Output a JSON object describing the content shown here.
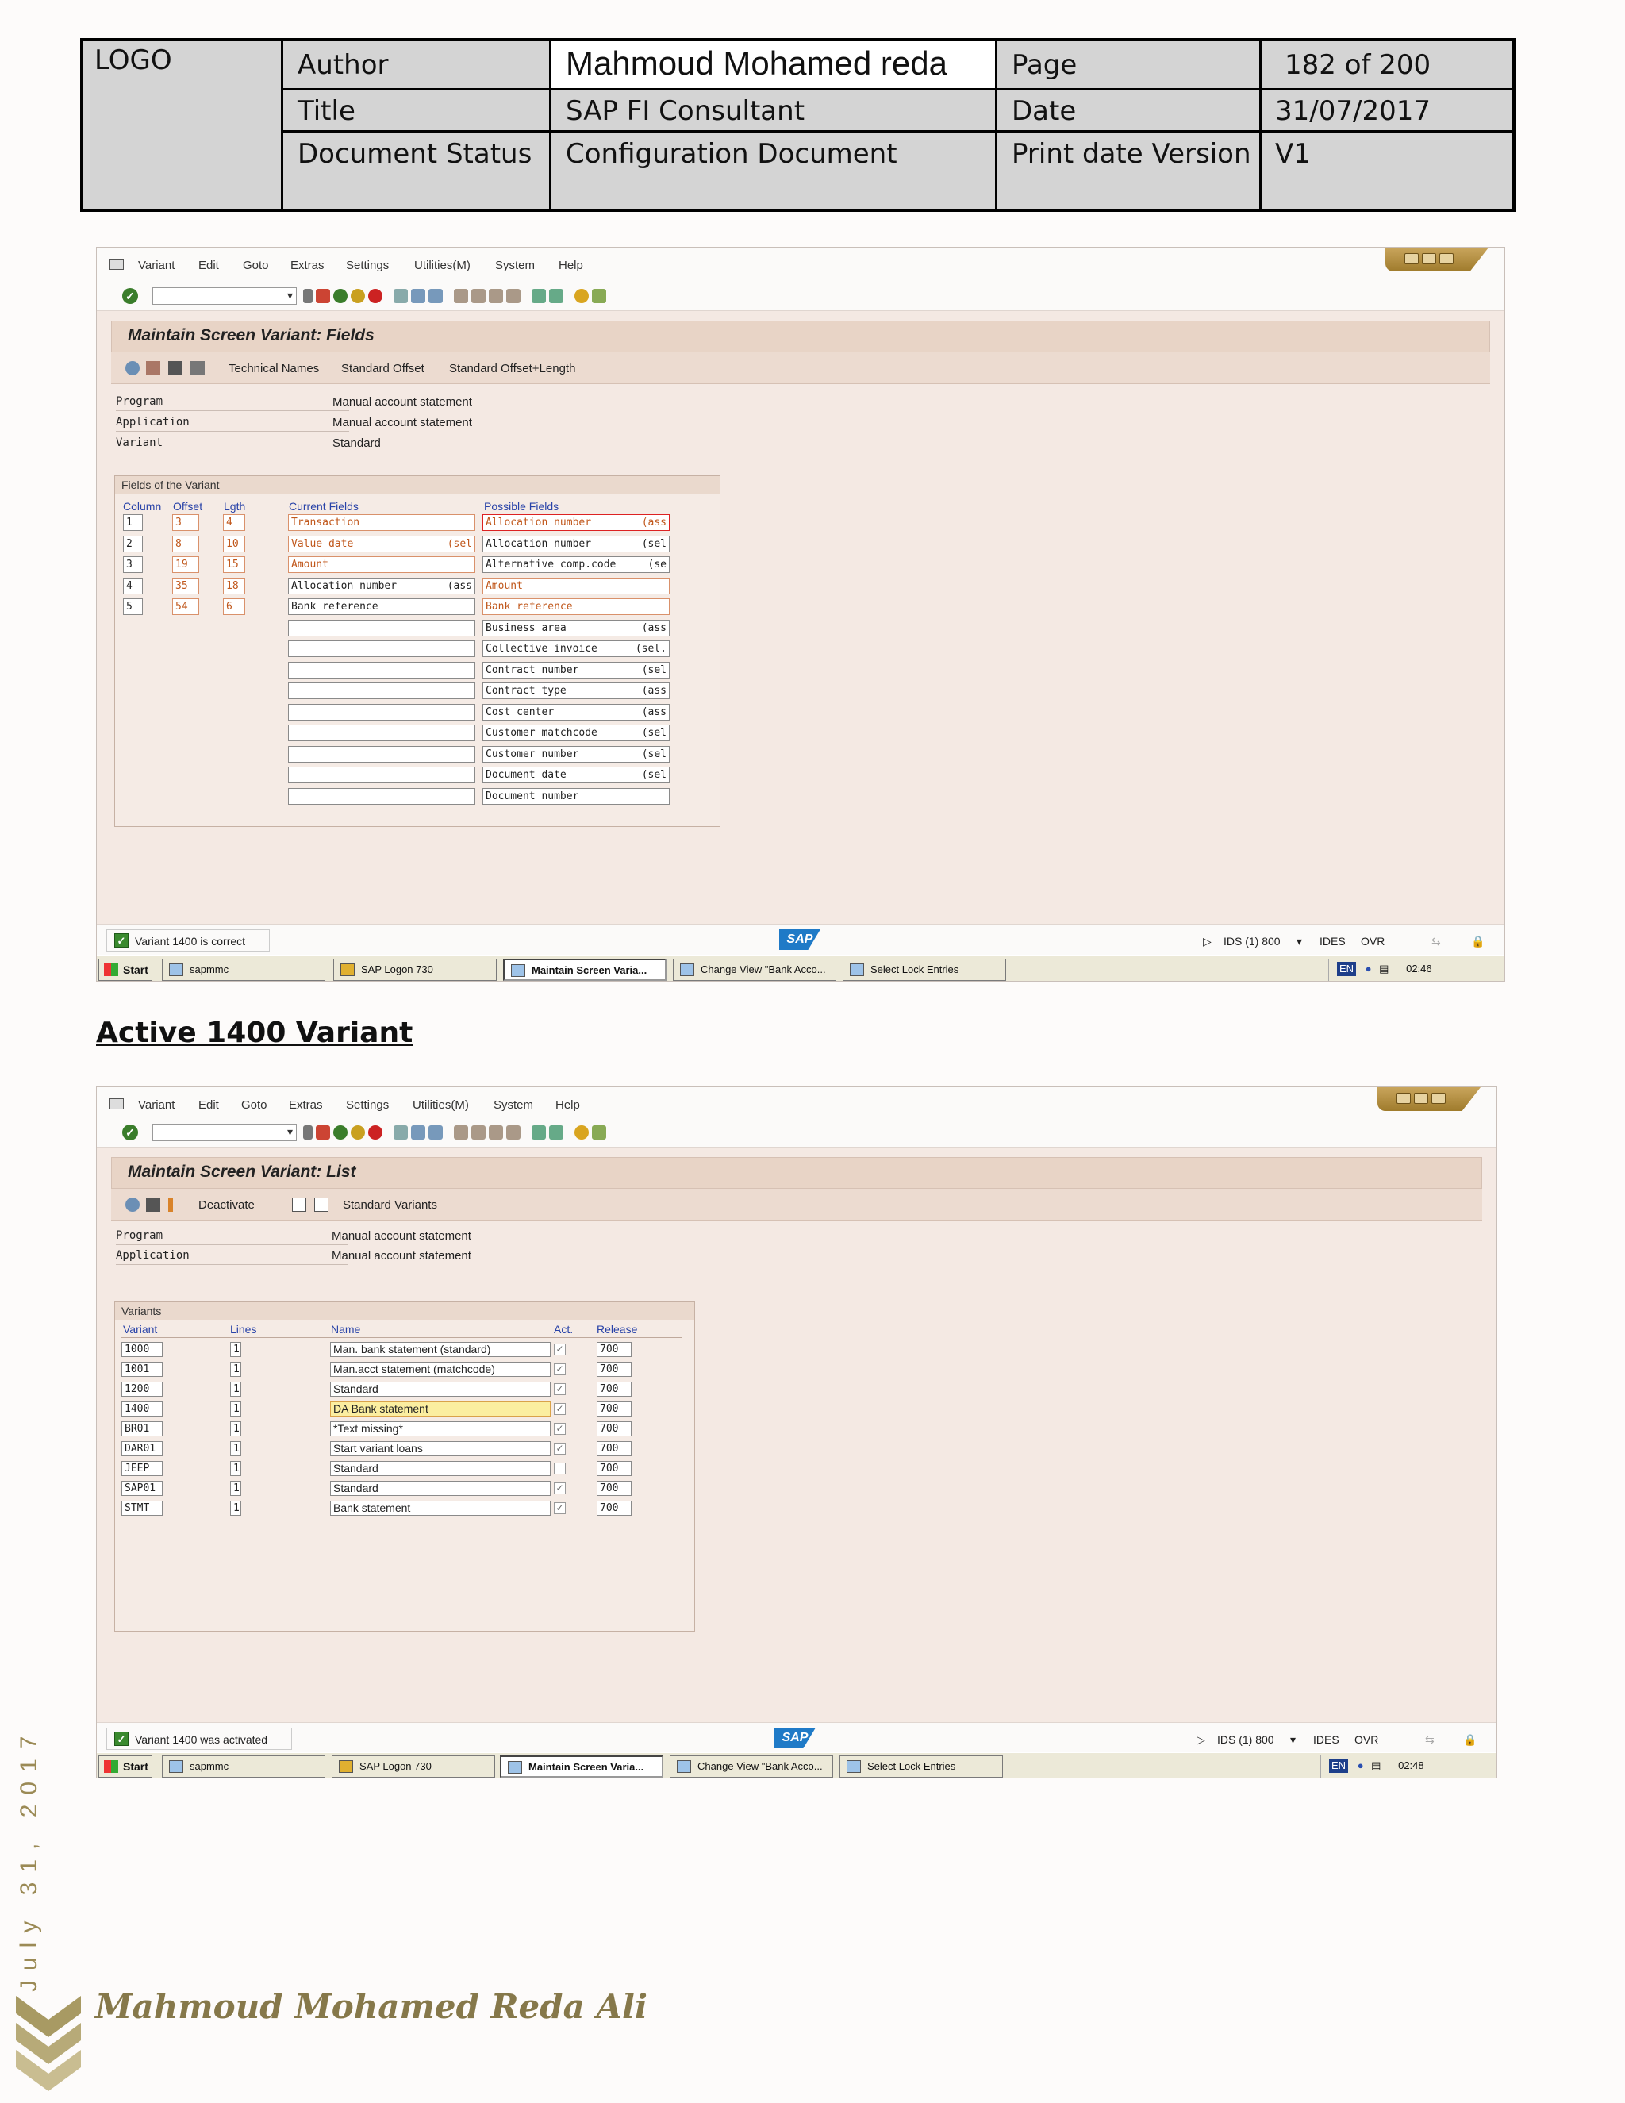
{
  "header": {
    "logo": "LOGO",
    "author_label": "Author",
    "author_value": "Mahmoud Mohamed reda",
    "page_label": "Page",
    "page_value": "182 of 200",
    "title_label": "Title",
    "title_value": "SAP FI Consultant",
    "date_label": "Date",
    "date_value": "31/07/2017",
    "status_label": "Document Status",
    "status_value": "Configuration Document",
    "version_label": "Print date Version",
    "version_value": "V1"
  },
  "menu": [
    "Variant",
    "Edit",
    "Goto",
    "Extras",
    "Settings",
    "Utilities(M)",
    "System",
    "Help"
  ],
  "screen1": {
    "title": "Maintain Screen Variant: Fields",
    "toolbar": [
      "Technical Names",
      "Standard Offset",
      "Standard Offset+Length"
    ],
    "fields": [
      {
        "label": "Program",
        "value": "Manual account statement"
      },
      {
        "label": "Application",
        "value": "Manual account statement"
      },
      {
        "label": "Variant",
        "value": "Standard"
      }
    ],
    "group_title": "Fields of the Variant",
    "col_headers": [
      "Column",
      "Offset",
      "Lgth",
      "Current Fields",
      "Possible Fields"
    ],
    "rows": [
      {
        "col": "1",
        "off": "3",
        "len": "4",
        "field": "Transaction",
        "sfx": ""
      },
      {
        "col": "2",
        "off": "8",
        "len": "10",
        "field": "Value date",
        "sfx": "(sel"
      },
      {
        "col": "3",
        "off": "19",
        "len": "15",
        "field": "Amount",
        "sfx": ""
      },
      {
        "col": "4",
        "off": "35",
        "len": "18",
        "field": "Allocation number",
        "sfx": "(ass"
      },
      {
        "col": "5",
        "off": "54",
        "len": "6",
        "field": "Bank reference",
        "sfx": ""
      }
    ],
    "possible": [
      {
        "name": "Allocation number",
        "sfx": "(ass"
      },
      {
        "name": "Allocation number",
        "sfx": "(sel"
      },
      {
        "name": "Alternative comp.code",
        "sfx": "(se"
      },
      {
        "name": "Amount",
        "sfx": ""
      },
      {
        "name": "Bank reference",
        "sfx": ""
      },
      {
        "name": "Business area",
        "sfx": "(ass"
      },
      {
        "name": "Collective invoice",
        "sfx": "(sel."
      },
      {
        "name": "Contract number",
        "sfx": "(sel"
      },
      {
        "name": "Contract type",
        "sfx": "(ass"
      },
      {
        "name": "Cost center",
        "sfx": "(ass"
      },
      {
        "name": "Customer matchcode",
        "sfx": "(sel"
      },
      {
        "name": "Customer number",
        "sfx": "(sel"
      },
      {
        "name": "Document date",
        "sfx": "(sel"
      },
      {
        "name": "Document number",
        "sfx": ""
      }
    ],
    "status_message": "Variant 1400 is correct",
    "sys_info": "IDS (1) 800",
    "sys_client": "IDES",
    "ovr": "OVR",
    "clock": "02:46"
  },
  "section_heading": "Active 1400 Variant",
  "screen2": {
    "title": "Maintain Screen Variant: List",
    "toolbar": [
      "Deactivate",
      "Standard Variants"
    ],
    "fields": [
      {
        "label": "Program",
        "value": "Manual account statement"
      },
      {
        "label": "Application",
        "value": "Manual account statement"
      }
    ],
    "group_title": "Variants",
    "col_headers": [
      "Variant",
      "Lines",
      "Name",
      "Act.",
      "Release"
    ],
    "rows": [
      {
        "variant": "1000",
        "lines": "1",
        "name": "Man. bank statement (standard)",
        "act": true,
        "release": "700"
      },
      {
        "variant": "1001",
        "lines": "1",
        "name": "Man.acct statement (matchcode)",
        "act": true,
        "release": "700"
      },
      {
        "variant": "1200",
        "lines": "1",
        "name": "Standard",
        "act": true,
        "release": "700"
      },
      {
        "variant": "1400",
        "lines": "1",
        "name": "DA Bank statement",
        "act": true,
        "release": "700"
      },
      {
        "variant": "BR01",
        "lines": "1",
        "name": "*Text missing*",
        "act": true,
        "release": "700"
      },
      {
        "variant": "DAR01",
        "lines": "1",
        "name": "Start variant loans",
        "act": true,
        "release": "700"
      },
      {
        "variant": "JEEP",
        "lines": "1",
        "name": "Standard",
        "act": false,
        "release": "700"
      },
      {
        "variant": "SAP01",
        "lines": "1",
        "name": "Standard",
        "act": true,
        "release": "700"
      },
      {
        "variant": "STMT",
        "lines": "1",
        "name": "Bank statement",
        "act": true,
        "release": "700"
      }
    ],
    "status_message": "Variant 1400 was activated",
    "sys_info": "IDS (1) 800",
    "sys_client": "IDES",
    "ovr": "OVR",
    "clock": "02:48"
  },
  "taskbar": {
    "start": "Start",
    "items": [
      "sapmmc",
      "SAP Logon 730",
      "Maintain Screen Varia...",
      "Change View \"Bank Acco...",
      "Select Lock Entries"
    ],
    "lang": "EN"
  },
  "side_date": "July 31, 2017",
  "footer_name": "Mahmoud Mohamed Reda Ali",
  "colors": {
    "sap_bg": "#f4e9e3",
    "sap_title": "#e8d4c6",
    "header_gray": "#d4d4d4",
    "footer_gold": "#86784a",
    "field_orange": "#c0571b",
    "column_blue": "#2943a8"
  }
}
